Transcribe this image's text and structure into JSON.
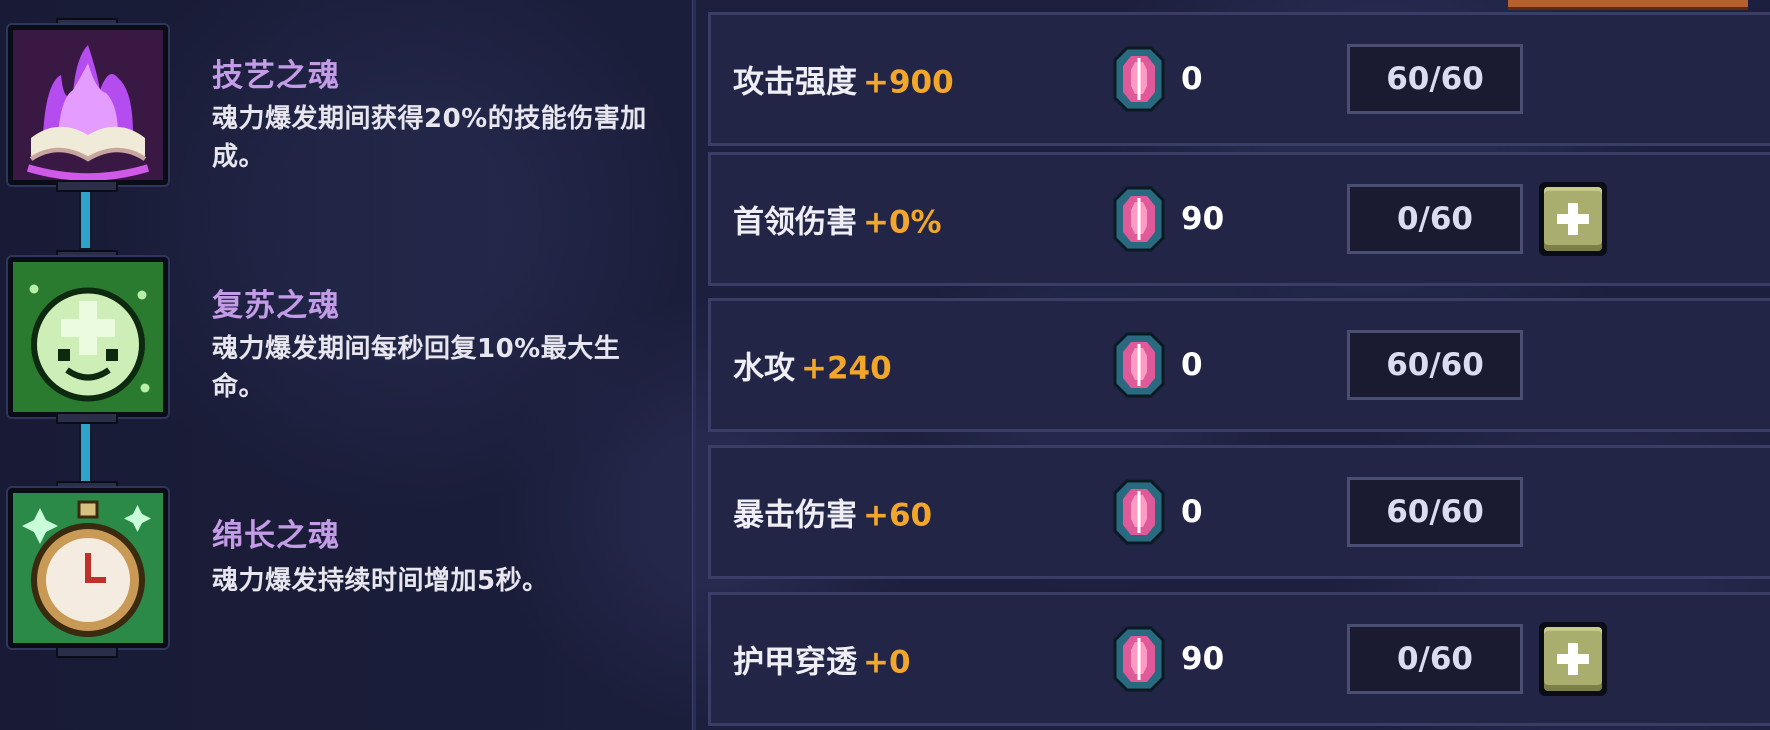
{
  "souls": [
    {
      "name": "技艺之魂",
      "desc": "魂力爆发期间获得20%的技能伤害加成。",
      "icon": "purple-flame-book-icon"
    },
    {
      "name": "复苏之魂",
      "desc": "魂力爆发期间每秒回复10%最大生命。",
      "icon": "green-smiling-cross-icon"
    },
    {
      "name": "绵长之魂",
      "desc": "魂力爆发持续时间增加5秒。",
      "icon": "stopwatch-icon"
    }
  ],
  "stats": [
    {
      "label": "攻击强度",
      "bonus": "+900",
      "cost": "0",
      "level": "60/60",
      "upgradable": false
    },
    {
      "label": "首领伤害",
      "bonus": "+0%",
      "cost": "90",
      "level": "0/60",
      "upgradable": true
    },
    {
      "label": "水攻",
      "bonus": "+240",
      "cost": "0",
      "level": "60/60",
      "upgradable": false
    },
    {
      "label": "暴击伤害",
      "bonus": "+60",
      "cost": "0",
      "level": "60/60",
      "upgradable": false
    },
    {
      "label": "护甲穿透",
      "bonus": "+0",
      "cost": "90",
      "level": "0/60",
      "upgradable": true
    }
  ],
  "colors": {
    "background": "#1c1f3d",
    "soul_name": "#c49be6",
    "bonus": "#f2a72a",
    "plus_button": "#a9ad6e",
    "connector": "#2fa3c9"
  }
}
